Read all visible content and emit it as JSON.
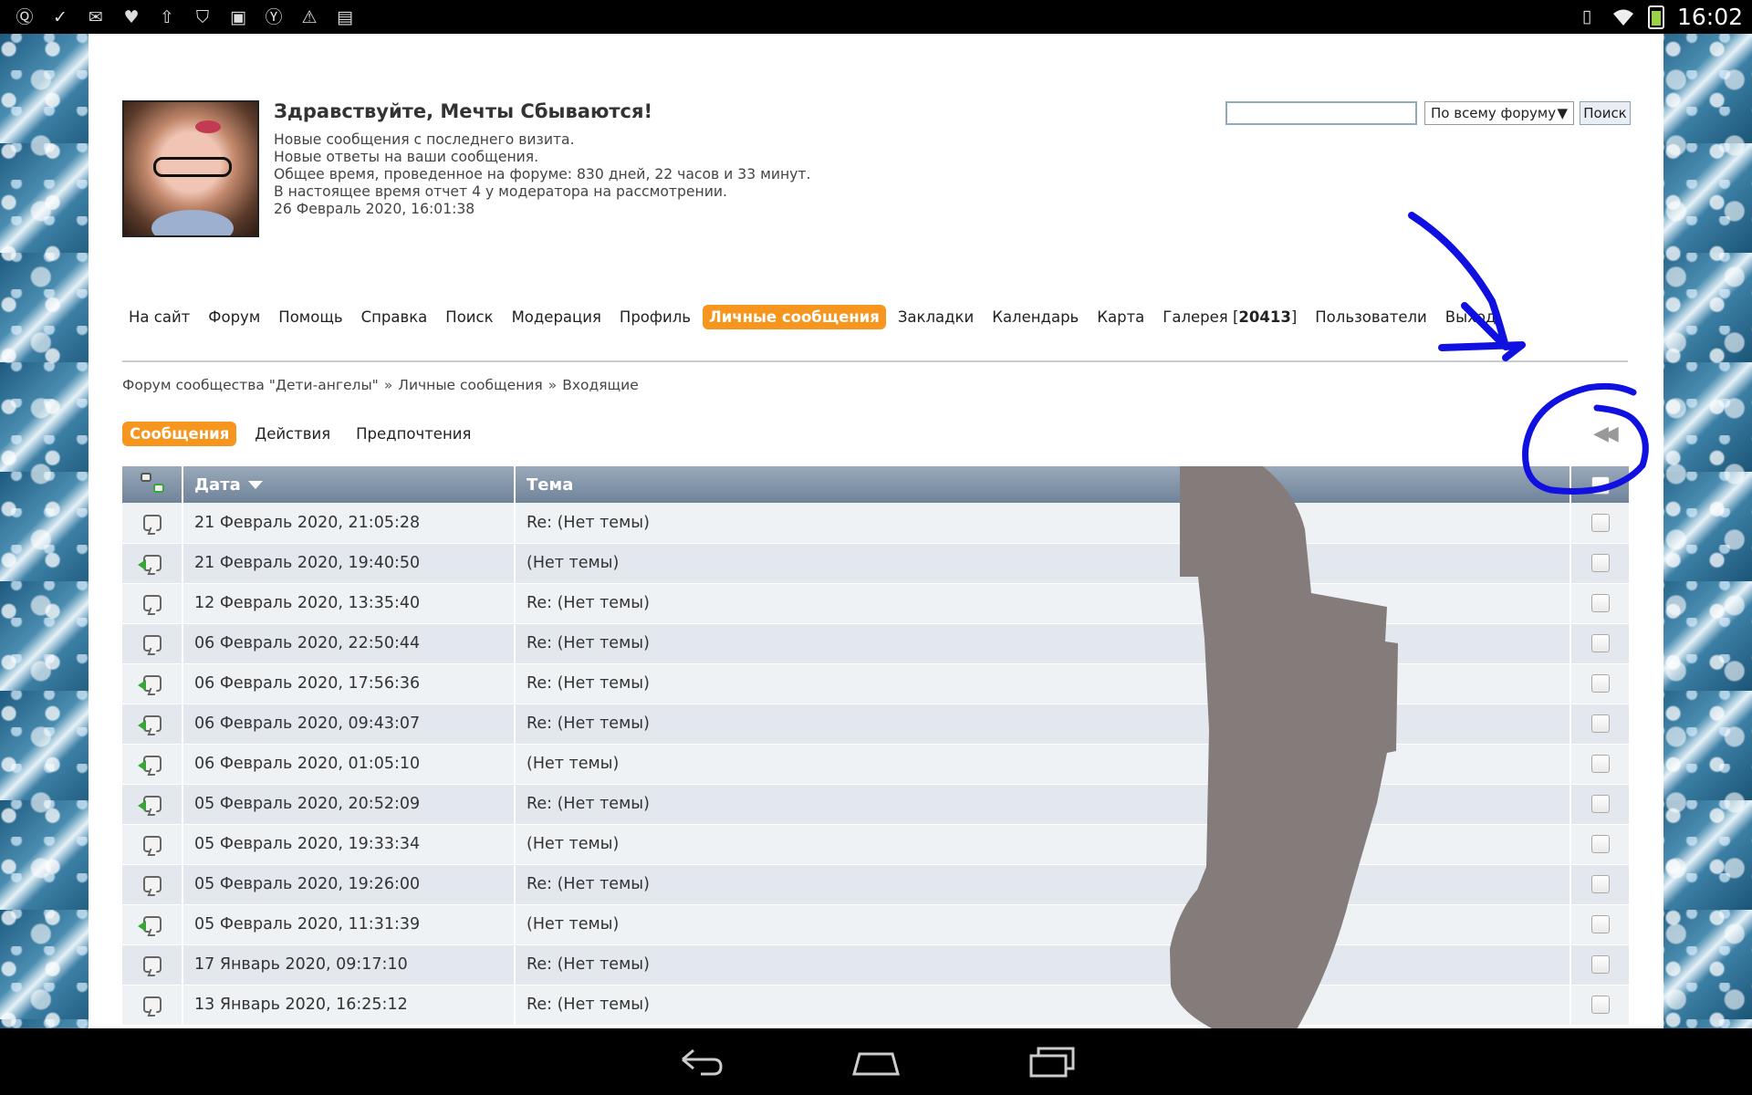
{
  "status_bar": {
    "time": "16:02",
    "icons_left": [
      "app-q-icon",
      "checkmark-icon",
      "mail-icon",
      "heart-icon",
      "upload-icon",
      "shield-icon",
      "image-icon",
      "yandex-icon",
      "warning-icon",
      "gmail-icon"
    ],
    "icons_right": [
      "vibrate-icon",
      "wifi-icon",
      "battery-icon"
    ]
  },
  "header": {
    "greeting": "Здравствуйте, Мечты Сбываются!",
    "lines": [
      "Новые сообщения с последнего визита.",
      "Новые ответы на ваши сообщения.",
      "Общее время, проведенное на форуме: 830 дней, 22 часов и 33 минут.",
      "В настоящее время отчет 4 у модератора на рассмотрении.",
      "26 Февраль 2020, 16:01:38"
    ],
    "search": {
      "value": "",
      "scope": "По всему форуму",
      "button": "Поиск"
    }
  },
  "nav": {
    "items": [
      "На сайт",
      "Форум",
      "Помощь",
      "Справка",
      "Поиск",
      "Модерация",
      "Профиль",
      "Личные сообщения",
      "Закладки",
      "Календарь",
      "Карта",
      "Галерея",
      "Пользователи",
      "Выход"
    ],
    "active": "Личные сообщения",
    "gallery_count": "20413"
  },
  "breadcrumb": [
    "Форум сообщества \"Дети-ангелы\"",
    "Личные сообщения",
    "Входящие"
  ],
  "breadcrumb_sep": "»",
  "subtabs": [
    "Сообщения",
    "Действия",
    "Предпочтения"
  ],
  "subtab_active": "Сообщения",
  "table": {
    "headers": {
      "date": "Дата",
      "subject": "Тема"
    },
    "rows": [
      {
        "date": "21 Февраль 2020, 21:05:28",
        "subject": "Re: (Нет темы)",
        "replied": false
      },
      {
        "date": "21 Февраль 2020, 19:40:50",
        "subject": "(Нет темы)",
        "replied": true
      },
      {
        "date": "12 Февраль 2020, 13:35:40",
        "subject": "Re: (Нет темы)",
        "replied": false
      },
      {
        "date": "06 Февраль 2020, 22:50:44",
        "subject": "Re: (Нет темы)",
        "replied": false
      },
      {
        "date": "06 Февраль 2020, 17:56:36",
        "subject": "Re: (Нет темы)",
        "replied": true
      },
      {
        "date": "06 Февраль 2020, 09:43:07",
        "subject": "Re: (Нет темы)",
        "replied": true
      },
      {
        "date": "06 Февраль 2020, 01:05:10",
        "subject": "(Нет темы)",
        "replied": true
      },
      {
        "date": "05 Февраль 2020, 20:52:09",
        "subject": "Re: (Нет темы)",
        "replied": true
      },
      {
        "date": "05 Февраль 2020, 19:33:34",
        "subject": "(Нет темы)",
        "replied": false
      },
      {
        "date": "05 Февраль 2020, 19:26:00",
        "subject": "Re: (Нет темы)",
        "replied": false
      },
      {
        "date": "05 Февраль 2020, 11:31:39",
        "subject": "(Нет темы)",
        "replied": true
      },
      {
        "date": "17 Январь 2020, 09:17:10",
        "subject": "Re: (Нет темы)",
        "replied": false
      },
      {
        "date": "13 Январь 2020, 16:25:12",
        "subject": "Re: (Нет темы)",
        "replied": false
      }
    ]
  },
  "colors": {
    "accent": "#f6961e",
    "table_header": "#7b8ea3",
    "annotation": "#1010e0",
    "redaction": "#847c7a"
  },
  "android_nav": [
    "back-icon",
    "home-icon",
    "recents-icon"
  ]
}
